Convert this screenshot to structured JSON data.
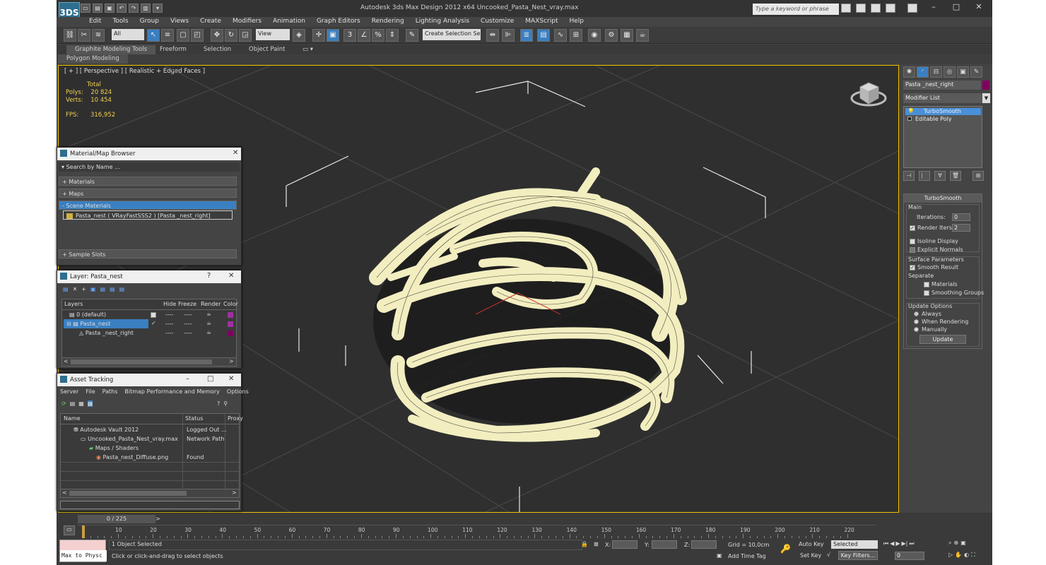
{
  "app": {
    "title": "Autodesk 3ds Max Design 2012 x64      Uncooked_Pasta_Nest_vray.max",
    "logo": "3DS",
    "search_placeholder": "Type a keyword or phrase"
  },
  "menu": [
    "Edit",
    "Tools",
    "Group",
    "Views",
    "Create",
    "Modifiers",
    "Animation",
    "Graph Editors",
    "Rendering",
    "Lighting Analysis",
    "Customize",
    "MAXScript",
    "Help"
  ],
  "toolbar": {
    "filter": "All",
    "refcoord": "View",
    "selset": "Create Selection Se"
  },
  "ribbon": {
    "tabs": [
      "Graphite Modeling Tools",
      "Freeform",
      "Selection",
      "Object Paint"
    ],
    "sub": "Polygon Modeling"
  },
  "viewport": {
    "label": "[ + ] [ Perspective ] [ Realistic + Edged Faces ]",
    "stats_total": "Total",
    "polys_label": "Polys:",
    "polys_value": "20 824",
    "verts_label": "Verts:",
    "verts_value": "10 454",
    "fps_label": "FPS:",
    "fps_value": "316,952"
  },
  "material_browser": {
    "title": "Material/Map Browser",
    "search": "Search by Name ...",
    "sections": [
      "+ Materials",
      "+ Maps",
      "- Scene Materials",
      "+ Sample Slots"
    ],
    "scene_item": "Pasta_nest  ( VRayFastSSS2 )  [Pasta _nest_right]"
  },
  "layer": {
    "title": "Layer: Pasta_nest",
    "help": "?",
    "headers": [
      "Layers",
      "Hide",
      "Freeze",
      "Render",
      "Color"
    ],
    "rows": [
      {
        "name": "0 (default)",
        "color": "#a030a0"
      },
      {
        "name": "Pasta_nest",
        "color": "#a030a0"
      },
      {
        "name": "Pasta _nest_right",
        "color": "#800060"
      }
    ],
    "dash": "----"
  },
  "asset": {
    "title": "Asset Tracking",
    "menu": [
      "Server",
      "File",
      "Paths",
      "Bitmap Performance and Memory",
      "Options"
    ],
    "headers": [
      "Name",
      "Status",
      "Proxy"
    ],
    "rows": [
      {
        "name": "Autodesk Vault 2012",
        "status": "Logged Out ..."
      },
      {
        "name": "Uncooked_Pasta_Nest_vray.max",
        "status": "Network Path"
      },
      {
        "name": "Maps / Shaders",
        "status": ""
      },
      {
        "name": "Pasta_nest_Diffuse.png",
        "status": "Found"
      }
    ]
  },
  "command": {
    "object_name": "Pasta _nest_right",
    "modifier_list": "Modifier List",
    "stack": [
      "TurboSmooth",
      "Editable Poly"
    ],
    "rollout_title": "TurboSmooth",
    "main": "Main",
    "iterations_label": "Iterations:",
    "iterations_value": "0",
    "render_iters_label": "Render Iters:",
    "render_iters_value": "2",
    "isoline": "Isoline Display",
    "explicit": "Explicit Normals",
    "surface": "Surface Parameters",
    "smooth_result": "Smooth Result",
    "separate": "Separate",
    "materials": "Materials",
    "smoothing_groups": "Smoothing Groups",
    "update_options": "Update Options",
    "always": "Always",
    "when_rendering": "When Rendering",
    "manually": "Manually",
    "update_btn": "Update"
  },
  "timeline": {
    "scrub": "0 / 225",
    "ticks": [
      "10",
      "20",
      "30",
      "40",
      "50",
      "60",
      "70",
      "80",
      "90",
      "100",
      "110",
      "120",
      "130",
      "140",
      "150",
      "160",
      "170",
      "180",
      "190",
      "200",
      "210",
      "220"
    ]
  },
  "status": {
    "maxscript": "Max to Physc",
    "selected": "1 Object Selected",
    "hint": "Click or click-and-drag to select objects",
    "x_label": "X:",
    "y_label": "Y:",
    "z_label": "Z:",
    "grid": "Grid = 10,0cm",
    "add_time_tag": "Add Time Tag",
    "auto_key": "Auto Key",
    "set_key": "Set Key",
    "key_mode": "Selected",
    "key_filters": "Key Filters...",
    "frame": "0"
  }
}
